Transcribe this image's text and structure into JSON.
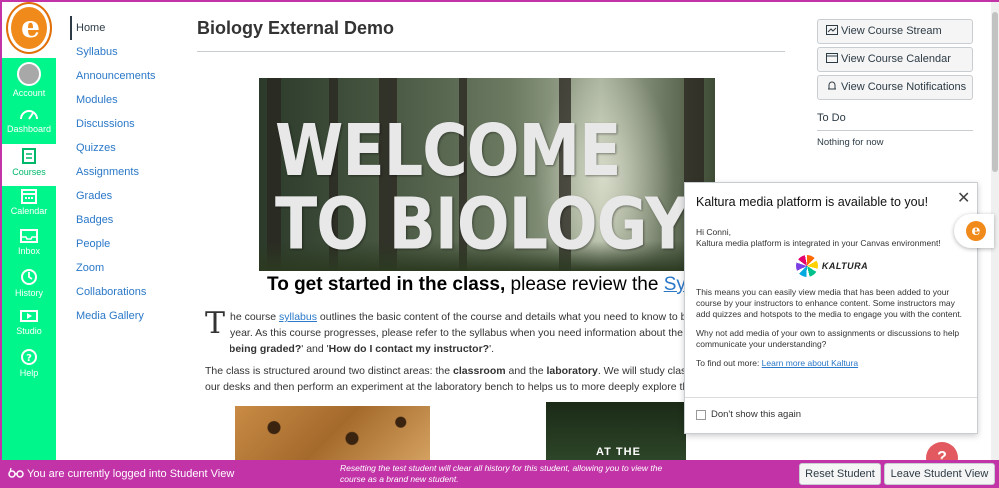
{
  "global_nav": {
    "items": [
      {
        "label": "Account",
        "icon": "avatar"
      },
      {
        "label": "Dashboard",
        "icon": "dashboard-icon"
      },
      {
        "label": "Courses",
        "icon": "courses-icon"
      },
      {
        "label": "Calendar",
        "icon": "calendar-icon"
      },
      {
        "label": "Inbox",
        "icon": "inbox-icon"
      },
      {
        "label": "History",
        "icon": "history-icon"
      },
      {
        "label": "Studio",
        "icon": "studio-icon"
      },
      {
        "label": "Help",
        "icon": "help-icon"
      }
    ],
    "active": "Courses",
    "color": "#00f58a"
  },
  "course_nav": {
    "items": [
      "Home",
      "Syllabus",
      "Announcements",
      "Modules",
      "Discussions",
      "Quizzes",
      "Assignments",
      "Grades",
      "Badges",
      "People",
      "Zoom",
      "Collaborations",
      "Media Gallery"
    ],
    "active": "Home"
  },
  "main": {
    "title": "Biology External Demo",
    "banner_line1": "WELCOME",
    "banner_line2": "TO BIOLOGY",
    "tagline_bold": "To get started in the class,",
    "tagline_rest": " please review the ",
    "tagline_link": "Syllab",
    "dropcap": "T",
    "para1_a": "he course ",
    "para1_link": "syllabus",
    "para1_b": " outlines the basic content of the course and details what you need to know to be",
    "para1_c": "year. As this course progresses, please refer to the syllabus when you need information about the co",
    "para1_d_bold": "am I being graded?",
    "para1_e": "' and '",
    "para1_f_bold": "How do I contact my instructor?",
    "para1_g": "'.",
    "para2_a": "The class is structured around two distinct areas: the ",
    "para2_b_bold": "classroom",
    "para2_c": " and the ",
    "para2_d_bold": "laboratory",
    "para2_e": ". We will study class to",
    "para2_f": "our desks and then perform an experiment at the laboratory bench to helps us to more deeply explore tha",
    "image2_text": "AT THE"
  },
  "sidebar": {
    "buttons": [
      "View Course Stream",
      "View Course Calendar",
      "View Course Notifications"
    ],
    "todo_heading": "To Do",
    "todo_empty": "Nothing for now"
  },
  "kaltura": {
    "title": "Kaltura media platform is available to you!",
    "greeting": "Hi Conni,",
    "intro": "Kaltura media platform is integrated in your Canvas environment!",
    "logo_text": "KALTURA",
    "p1": "This means you can easily view media that has been added to your course by your instructors to enhance content. Some instructors may add quizzes and hotspots to the media to engage you with the content.",
    "p2": "Why not add media of your own to assignments or discussions to help communicate your understanding?",
    "p3": "To find out more: ",
    "link": "Learn more about Kaltura",
    "checkbox_label": "Don't show this again"
  },
  "student_bar": {
    "text": "You are currently logged into Student View",
    "note": "Resetting the test student will clear all history for this student, allowing you to view the course as a brand new student.",
    "reset_label": "Reset Student",
    "leave_label": "Leave Student View",
    "color": "#c233a8"
  },
  "help_fab": "?"
}
